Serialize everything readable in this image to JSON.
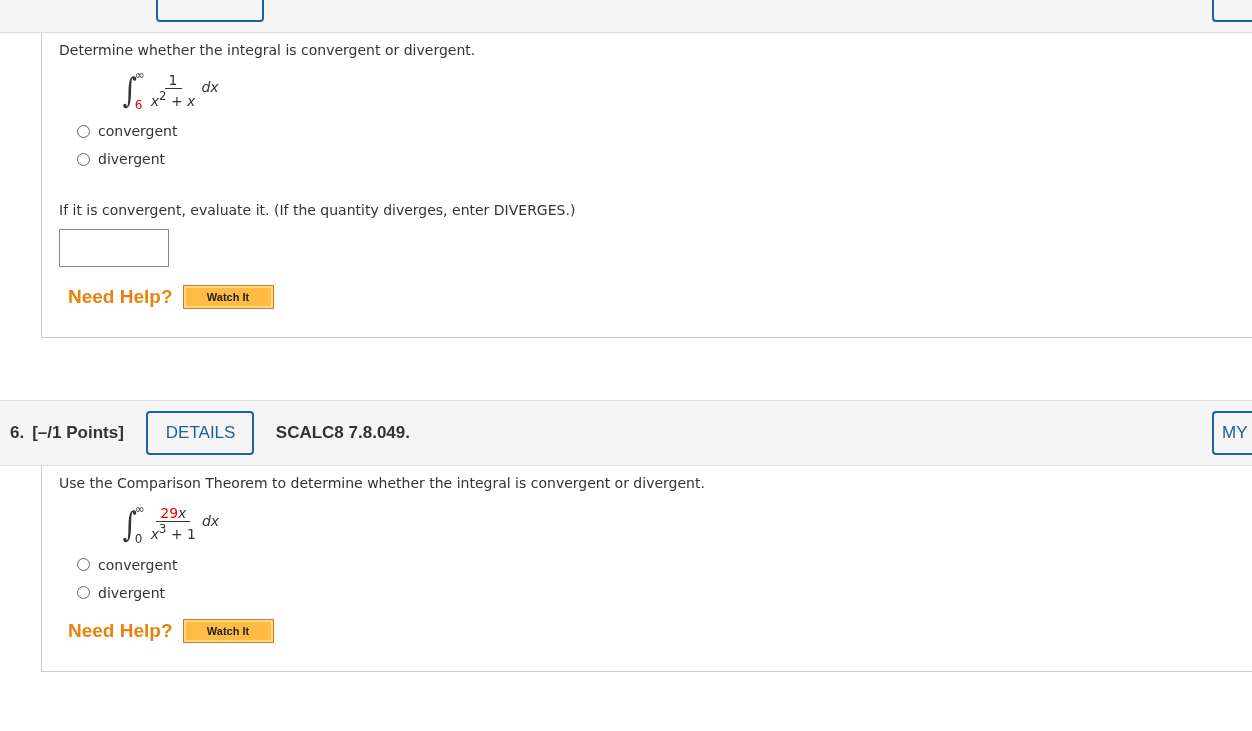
{
  "questions": [
    {
      "prompt": "Determine whether the integral is convergent or divergent.",
      "integral": {
        "sign": "∫",
        "upper": "∞",
        "lower": {
          "text": "6",
          "given": true
        },
        "numerator": [
          {
            "text": "1",
            "given": false
          }
        ],
        "denominator": "*x*$^{2}$ + *x*",
        "differential": "dx"
      },
      "options": [
        {
          "label": "convergent",
          "selected": false
        },
        {
          "label": "divergent",
          "selected": false
        }
      ],
      "followup": {
        "prompt": "If it is convergent, evaluate it. (If the quantity diverges, enter DIVERGES.)"
      },
      "help": {
        "label": "Need Help?",
        "button": "Watch It"
      }
    },
    {
      "number": "6.",
      "points": "[–/1 Points]",
      "details_button": "DETAILS",
      "code": "SCALC8 7.8.049.",
      "right_button": "MY",
      "prompt": "Use the Comparison Theorem to determine whether the integral is convergent or divergent.",
      "integral": {
        "sign": "∫",
        "upper": "∞",
        "lower": {
          "text": "0",
          "given": false
        },
        "numerator": [
          {
            "text": "29",
            "given": true
          },
          {
            "text": "*x*",
            "given": false
          }
        ],
        "denominator": "*x*$^{3}$ + 1",
        "differential": "dx"
      },
      "options": [
        {
          "label": "convergent",
          "selected": false
        },
        {
          "label": "divergent",
          "selected": false
        }
      ],
      "help": {
        "label": "Need Help?",
        "button": "Watch It"
      }
    }
  ]
}
